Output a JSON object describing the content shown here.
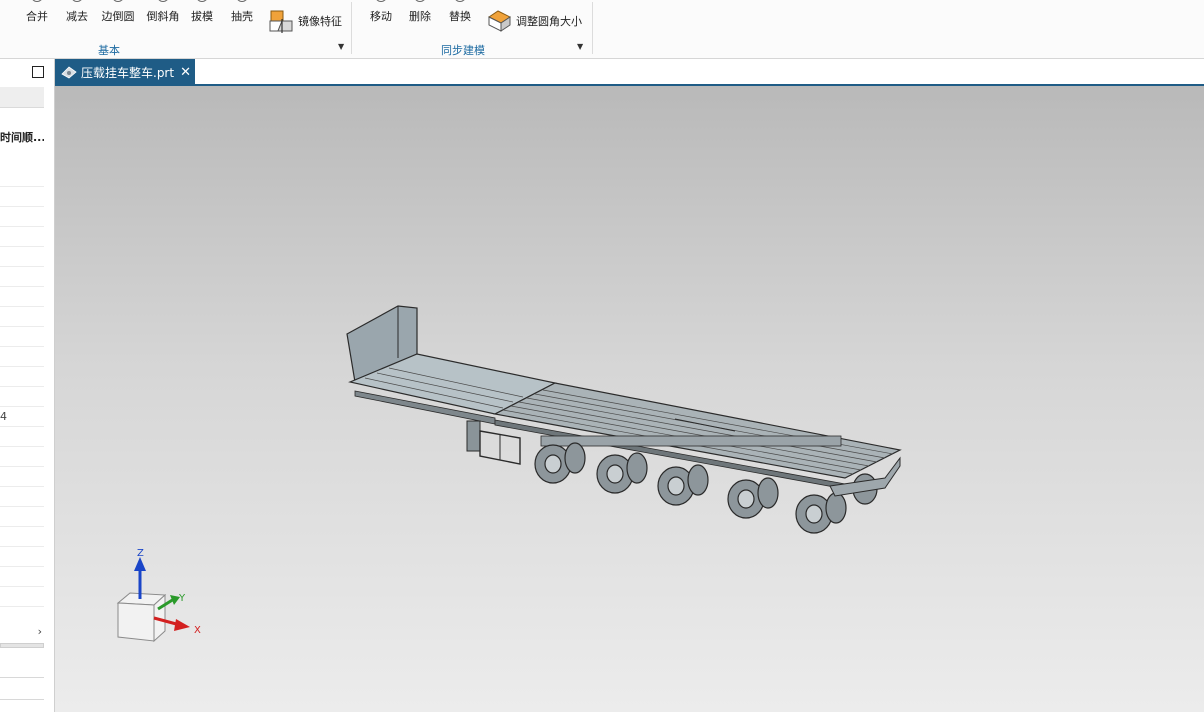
{
  "ribbon": {
    "basic_buttons": [
      "合并",
      "减去",
      "边倒圆",
      "倒斜角",
      "拔模",
      "抽壳"
    ],
    "mirror_feature": "镜像特征",
    "basic_group": "基本",
    "sync_buttons": [
      "移动",
      "删除",
      "替换"
    ],
    "resize_blend": "调整圆角大小",
    "sync_group": "同步建模"
  },
  "left_panel": {
    "column_header": "时间顺...",
    "row_value": "4"
  },
  "tab": {
    "title": "压载挂车整车.prt",
    "close": "✕"
  },
  "triad": {
    "z_label": "Z",
    "y_label": "Y",
    "x_label": "X"
  },
  "colors": {
    "tab_active": "#1f5c86",
    "group_label": "#1c6aa1",
    "axis_x": "#d32020",
    "axis_y": "#2a9a2a",
    "axis_z": "#1a45c8"
  }
}
